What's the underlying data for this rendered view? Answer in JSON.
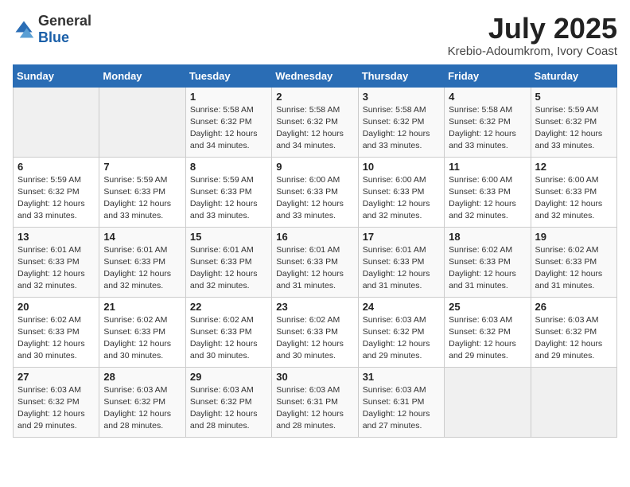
{
  "logo": {
    "general": "General",
    "blue": "Blue"
  },
  "title": {
    "month_year": "July 2025",
    "location": "Krebio-Adoumkrom, Ivory Coast"
  },
  "weekdays": [
    "Sunday",
    "Monday",
    "Tuesday",
    "Wednesday",
    "Thursday",
    "Friday",
    "Saturday"
  ],
  "weeks": [
    [
      {
        "day": "",
        "info": ""
      },
      {
        "day": "",
        "info": ""
      },
      {
        "day": "1",
        "info": "Sunrise: 5:58 AM\nSunset: 6:32 PM\nDaylight: 12 hours and 34 minutes."
      },
      {
        "day": "2",
        "info": "Sunrise: 5:58 AM\nSunset: 6:32 PM\nDaylight: 12 hours and 34 minutes."
      },
      {
        "day": "3",
        "info": "Sunrise: 5:58 AM\nSunset: 6:32 PM\nDaylight: 12 hours and 33 minutes."
      },
      {
        "day": "4",
        "info": "Sunrise: 5:58 AM\nSunset: 6:32 PM\nDaylight: 12 hours and 33 minutes."
      },
      {
        "day": "5",
        "info": "Sunrise: 5:59 AM\nSunset: 6:32 PM\nDaylight: 12 hours and 33 minutes."
      }
    ],
    [
      {
        "day": "6",
        "info": "Sunrise: 5:59 AM\nSunset: 6:32 PM\nDaylight: 12 hours and 33 minutes."
      },
      {
        "day": "7",
        "info": "Sunrise: 5:59 AM\nSunset: 6:33 PM\nDaylight: 12 hours and 33 minutes."
      },
      {
        "day": "8",
        "info": "Sunrise: 5:59 AM\nSunset: 6:33 PM\nDaylight: 12 hours and 33 minutes."
      },
      {
        "day": "9",
        "info": "Sunrise: 6:00 AM\nSunset: 6:33 PM\nDaylight: 12 hours and 33 minutes."
      },
      {
        "day": "10",
        "info": "Sunrise: 6:00 AM\nSunset: 6:33 PM\nDaylight: 12 hours and 32 minutes."
      },
      {
        "day": "11",
        "info": "Sunrise: 6:00 AM\nSunset: 6:33 PM\nDaylight: 12 hours and 32 minutes."
      },
      {
        "day": "12",
        "info": "Sunrise: 6:00 AM\nSunset: 6:33 PM\nDaylight: 12 hours and 32 minutes."
      }
    ],
    [
      {
        "day": "13",
        "info": "Sunrise: 6:01 AM\nSunset: 6:33 PM\nDaylight: 12 hours and 32 minutes."
      },
      {
        "day": "14",
        "info": "Sunrise: 6:01 AM\nSunset: 6:33 PM\nDaylight: 12 hours and 32 minutes."
      },
      {
        "day": "15",
        "info": "Sunrise: 6:01 AM\nSunset: 6:33 PM\nDaylight: 12 hours and 32 minutes."
      },
      {
        "day": "16",
        "info": "Sunrise: 6:01 AM\nSunset: 6:33 PM\nDaylight: 12 hours and 31 minutes."
      },
      {
        "day": "17",
        "info": "Sunrise: 6:01 AM\nSunset: 6:33 PM\nDaylight: 12 hours and 31 minutes."
      },
      {
        "day": "18",
        "info": "Sunrise: 6:02 AM\nSunset: 6:33 PM\nDaylight: 12 hours and 31 minutes."
      },
      {
        "day": "19",
        "info": "Sunrise: 6:02 AM\nSunset: 6:33 PM\nDaylight: 12 hours and 31 minutes."
      }
    ],
    [
      {
        "day": "20",
        "info": "Sunrise: 6:02 AM\nSunset: 6:33 PM\nDaylight: 12 hours and 30 minutes."
      },
      {
        "day": "21",
        "info": "Sunrise: 6:02 AM\nSunset: 6:33 PM\nDaylight: 12 hours and 30 minutes."
      },
      {
        "day": "22",
        "info": "Sunrise: 6:02 AM\nSunset: 6:33 PM\nDaylight: 12 hours and 30 minutes."
      },
      {
        "day": "23",
        "info": "Sunrise: 6:02 AM\nSunset: 6:33 PM\nDaylight: 12 hours and 30 minutes."
      },
      {
        "day": "24",
        "info": "Sunrise: 6:03 AM\nSunset: 6:32 PM\nDaylight: 12 hours and 29 minutes."
      },
      {
        "day": "25",
        "info": "Sunrise: 6:03 AM\nSunset: 6:32 PM\nDaylight: 12 hours and 29 minutes."
      },
      {
        "day": "26",
        "info": "Sunrise: 6:03 AM\nSunset: 6:32 PM\nDaylight: 12 hours and 29 minutes."
      }
    ],
    [
      {
        "day": "27",
        "info": "Sunrise: 6:03 AM\nSunset: 6:32 PM\nDaylight: 12 hours and 29 minutes."
      },
      {
        "day": "28",
        "info": "Sunrise: 6:03 AM\nSunset: 6:32 PM\nDaylight: 12 hours and 28 minutes."
      },
      {
        "day": "29",
        "info": "Sunrise: 6:03 AM\nSunset: 6:32 PM\nDaylight: 12 hours and 28 minutes."
      },
      {
        "day": "30",
        "info": "Sunrise: 6:03 AM\nSunset: 6:31 PM\nDaylight: 12 hours and 28 minutes."
      },
      {
        "day": "31",
        "info": "Sunrise: 6:03 AM\nSunset: 6:31 PM\nDaylight: 12 hours and 27 minutes."
      },
      {
        "day": "",
        "info": ""
      },
      {
        "day": "",
        "info": ""
      }
    ]
  ]
}
